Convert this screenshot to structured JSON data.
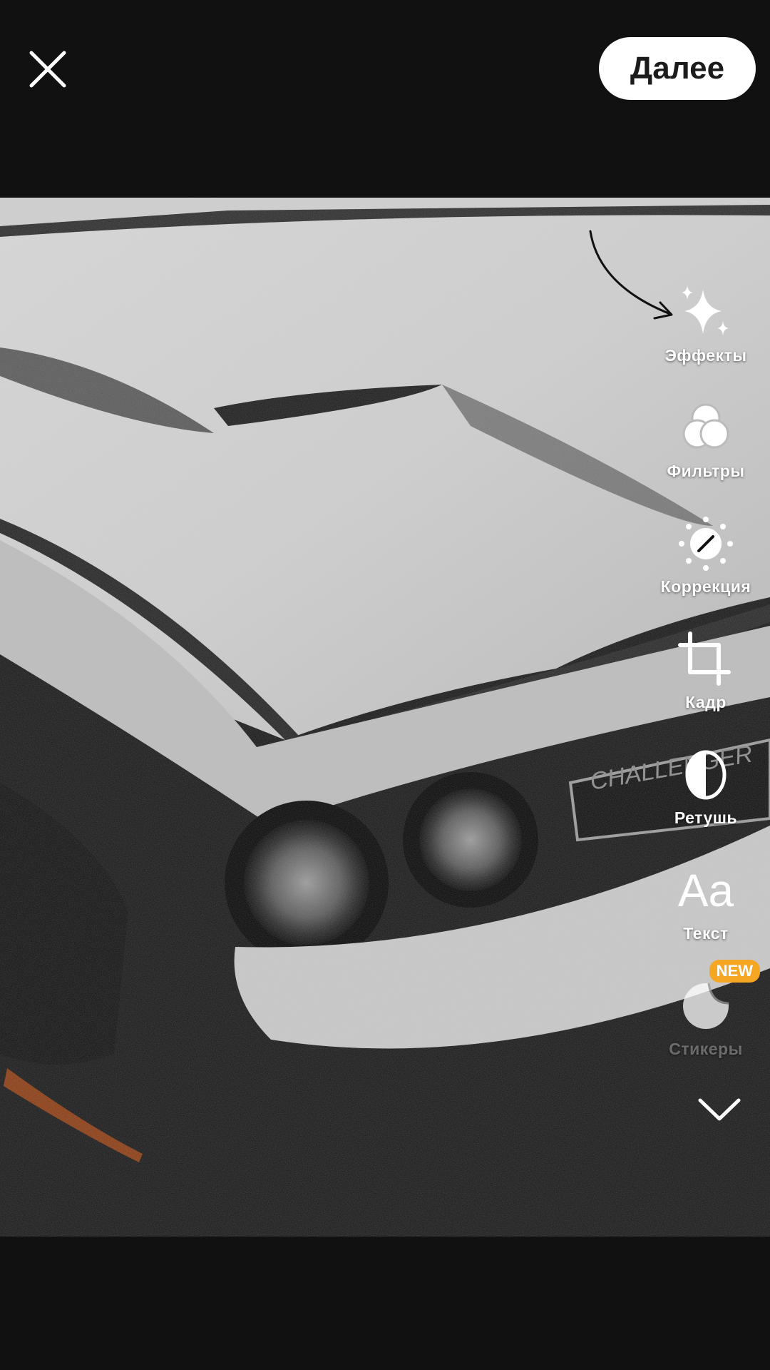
{
  "header": {
    "close_icon": "close-icon",
    "next_label": "Далее"
  },
  "tools": [
    {
      "id": "effects",
      "label": "Эффекты",
      "icon": "sparkles-icon"
    },
    {
      "id": "filters",
      "label": "Фильтры",
      "icon": "filters-icon"
    },
    {
      "id": "correction",
      "label": "Коррекция",
      "icon": "adjust-icon"
    },
    {
      "id": "crop",
      "label": "Кадр",
      "icon": "crop-icon"
    },
    {
      "id": "retouch",
      "label": "Ретушь",
      "icon": "retouch-icon"
    },
    {
      "id": "text",
      "label": "Текст",
      "icon": "text-icon",
      "glyph": "Aa"
    },
    {
      "id": "stickers",
      "label": "Стикеры",
      "icon": "sticker-icon",
      "badge": "NEW"
    }
  ],
  "more_icon": "chevron-down-icon",
  "photo": {
    "subject": "snow-covered car hood",
    "grille_text": "CHALLENGER"
  },
  "colors": {
    "background": "#111112",
    "badge": "#f5a623",
    "button_bg": "#ffffff"
  }
}
